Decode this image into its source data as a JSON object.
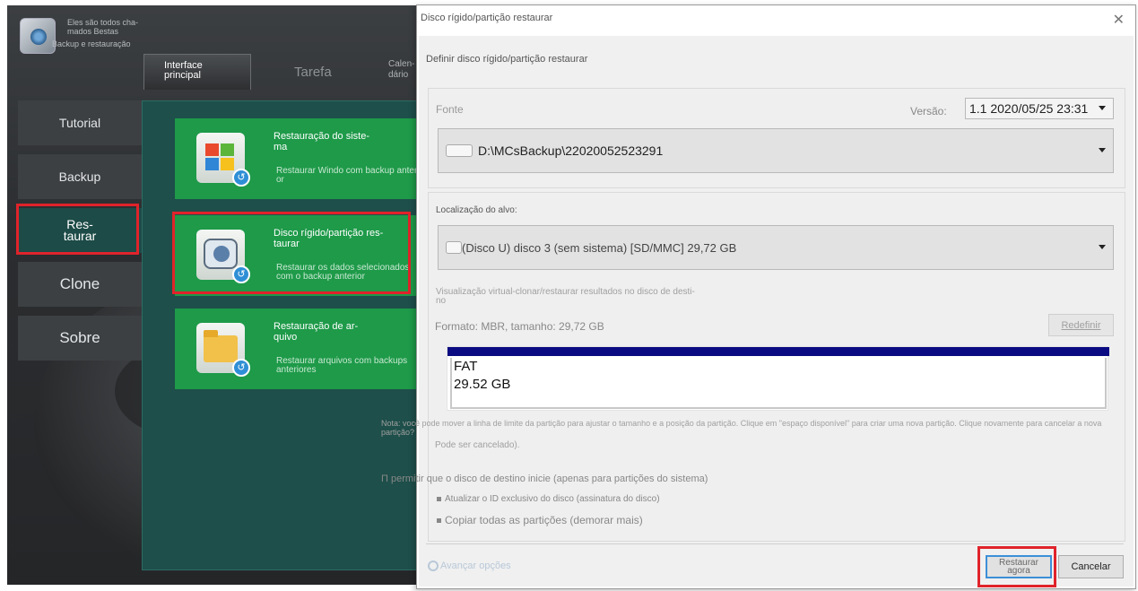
{
  "app": {
    "tagline": "Eles são todos cha-\nmados Bestas",
    "subtitle": "Backup e restauração",
    "tabs": [
      {
        "label": "Interface\nprincipal"
      },
      {
        "label": "Tarefa"
      },
      {
        "label": "Calen-\ndário"
      }
    ],
    "nav": [
      {
        "label": "Tutorial"
      },
      {
        "label": "Backup"
      },
      {
        "label": "Res-\ntaurar"
      },
      {
        "label": "Clone"
      },
      {
        "label": "Sobre"
      }
    ],
    "cards": [
      {
        "title": "Restauração do siste-\nma",
        "desc": "Restaurar Windo com backup anteri-\nor"
      },
      {
        "title": "Disco rígido/partição res-\ntaurar",
        "desc": "Restaurar os dados selecionados\ncom o backup anterior"
      },
      {
        "title": "Restauração de ar-\nquivo",
        "desc": "Restaurar arquivos com backups\nanteriores"
      }
    ]
  },
  "dialog": {
    "title": "Disco rígido/partição restaurar",
    "heading": "Definir disco rígido/partição restaurar",
    "source_label": "Fonte",
    "version_label": "Versão:",
    "version_value": "1.1  2020/05/25 23:31",
    "source_path": "D:\\MCsBackup\\22020052523291",
    "target_label": "Localização do alvo:",
    "target_value": "(Disco U) disco 3 (sem sistema) [SD/MMC] 29,72 GB",
    "preview_label": "Visualização virtual-clonar/restaurar resultados no disco de desti-\nno",
    "format_text": "Formato: MBR, tamanho: 29,72 GB",
    "reset_button": "Redefinir",
    "partition": {
      "fs": "FAT",
      "size": "29.52 GB"
    },
    "note": "Nota: você pode mover a linha de limite da partição para ajustar o tamanho e a posição da partição. Clique em \"espaço disponível\" para criar uma nova partição. Clique novamente para cancelar a nova partição?",
    "note_cont": "Pode ser cancelado).",
    "options": [
      "Π permitir que o disco de destino inicie (apenas para partições do sistema)",
      "Atualizar o ID exclusivo do disco (assinatura do disco)",
      "Copiar todas as partições (demorar mais)"
    ],
    "advanced_link": "Avançar opções",
    "restore_button": "Restaurar\nagora",
    "cancel_button": "Cancelar"
  }
}
